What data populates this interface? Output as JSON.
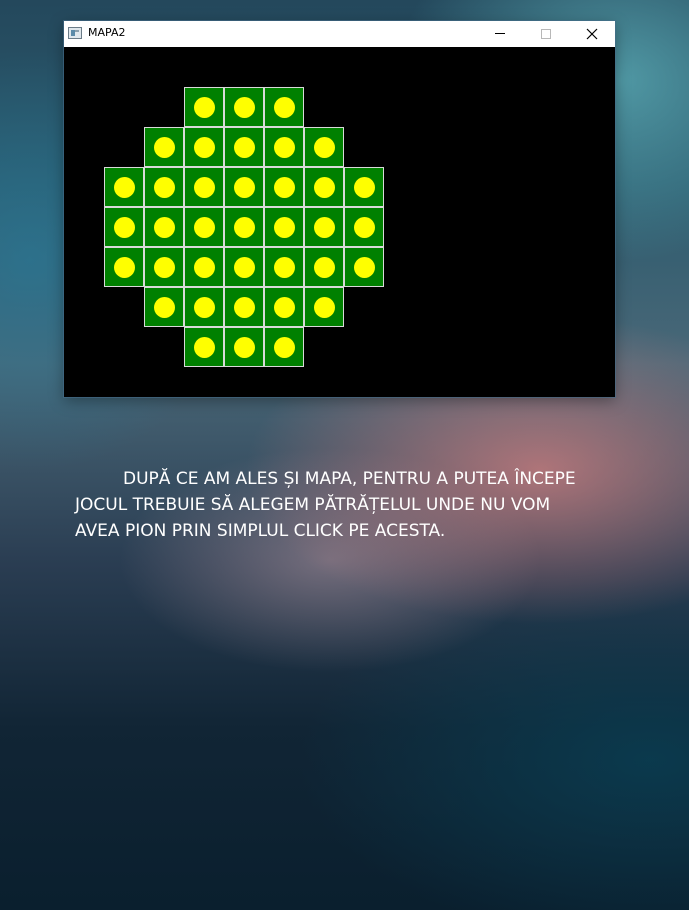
{
  "window": {
    "title": "MAPA2",
    "app_icon": "window-app-icon",
    "controls": [
      "minimize-icon",
      "maximize-icon",
      "close-icon"
    ]
  },
  "board": {
    "rows": 7,
    "cols": 7,
    "layout": [
      "..XXX..",
      ".XXXXX.",
      "XXXXXXX",
      "XXXXXXX",
      "XXXXXXX",
      ".XXXXX.",
      "..XXX.."
    ],
    "cell_color": "#008000",
    "cell_border_color": "#d9d9d9",
    "peg_color": "#ffff00",
    "background_color": "#000000"
  },
  "caption": {
    "lines": [
      "DUPĂ CE AM ALES ȘI MAPA, PENTRU A PUTEA ÎNCEPE",
      "JOCUL TREBUIE SĂ ALEGEM PĂTRĂȚELUL UNDE NU VOM",
      "AVEA PION PRIN SIMPLUL CLICK PE ACESTA."
    ]
  }
}
